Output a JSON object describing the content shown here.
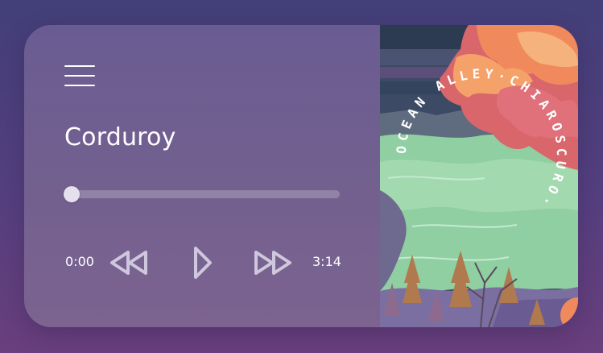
{
  "player": {
    "track_title": "Corduroy",
    "current_time": "0:00",
    "total_time": "3:14",
    "progress": 0.0
  },
  "icons": {
    "menu": "hamburger-menu-icon",
    "rewind": "rewind-icon",
    "play": "play-icon",
    "forward": "fast-forward-icon"
  },
  "album_art": {
    "ring_text": "OCEAN ALLEY·CHIAROSCURO·"
  },
  "colors": {
    "background": "#4b3f7c",
    "panel": "#6f5e91",
    "text": "#ffffff",
    "track": "rgba(255,255,255,0.22)",
    "thumb": "#e6e0ee"
  }
}
